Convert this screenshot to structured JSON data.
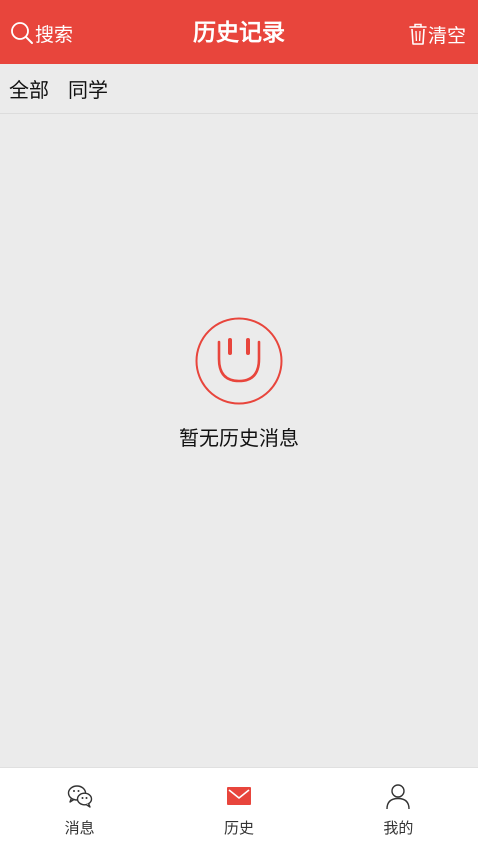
{
  "header": {
    "search_label": "搜索",
    "title": "历史记录",
    "clear_label": "清空"
  },
  "filters": {
    "all": "全部",
    "classmates": "同学"
  },
  "empty_state": {
    "message": "暂无历史消息"
  },
  "tabbar": {
    "items": [
      {
        "label": "消息",
        "icon": "chat-bubbles-icon"
      },
      {
        "label": "历史",
        "icon": "mail-icon"
      },
      {
        "label": "我的",
        "icon": "person-icon"
      }
    ],
    "active_index": 1
  },
  "colors": {
    "accent": "#e8453c",
    "background": "#ebebeb",
    "tabbar_background": "#ffffff"
  }
}
